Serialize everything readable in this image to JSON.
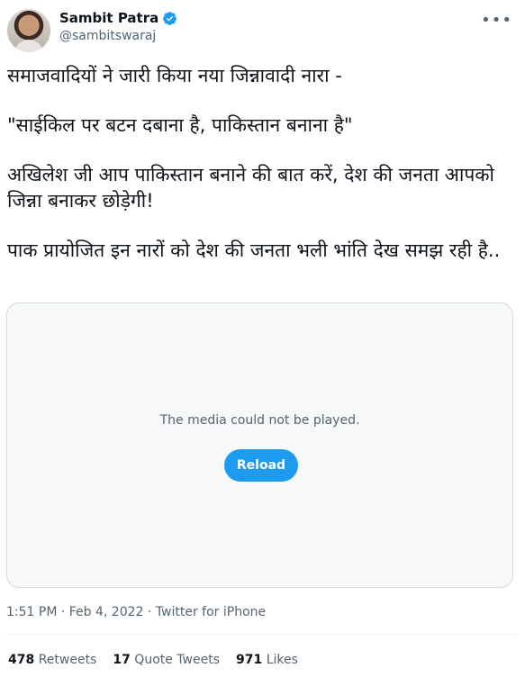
{
  "user": {
    "name": "Sambit Patra",
    "handle": "@sambitswaraj"
  },
  "tweet": {
    "line1": "समाजवादियों ने जारी किया नया जिन्नावादी नारा -",
    "line2": "\"साईकिल पर बटन दबाना है, पाकिस्तान बनाना है\"",
    "line3": "अखिलेश जी आप पाकिस्तान बनाने की बात करें, देश की जनता आपको जिन्ना बनाकर छोड़ेगी!",
    "line4": "पाक प्रायोजित इन नारों को देश की जनता भली भांति देख समझ रही है.."
  },
  "media": {
    "message": "The media could not be played.",
    "reload_label": "Reload"
  },
  "meta": {
    "time": "1:51 PM · Feb 4, 2022 · Twitter for iPhone"
  },
  "stats": {
    "retweets_count": "478",
    "retweets_label": "Retweets",
    "quotes_count": "17",
    "quotes_label": "Quote Tweets",
    "likes_count": "971",
    "likes_label": "Likes"
  },
  "colors": {
    "accent": "#1d9bf0",
    "muted": "#536471"
  }
}
